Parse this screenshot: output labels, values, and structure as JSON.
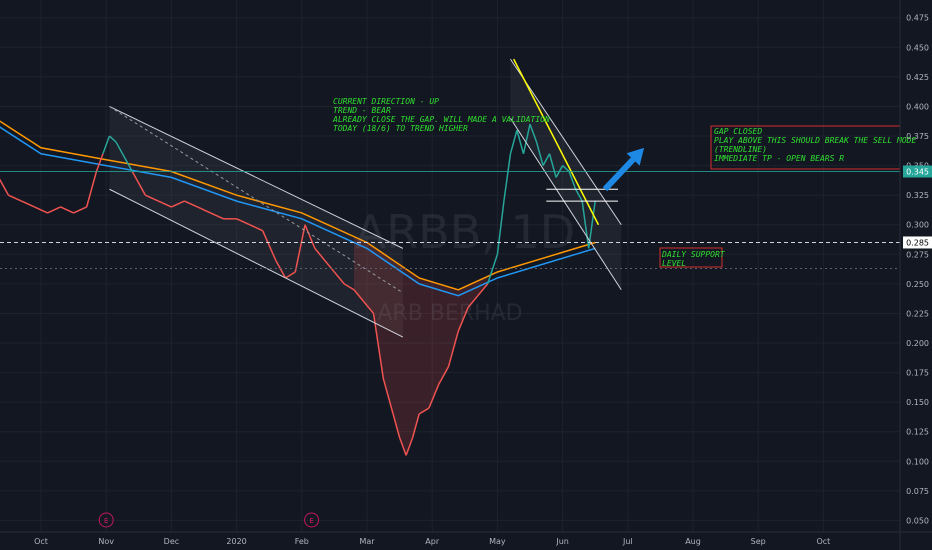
{
  "chart_data": {
    "type": "line",
    "symbol": "ARBB, 1D",
    "company": "ARB BERHAD",
    "x_tick_labels": [
      "Oct",
      "Nov",
      "Dec",
      "2020",
      "Feb",
      "Mar",
      "Apr",
      "May",
      "Jun",
      "Jul",
      "Aug",
      "Sep",
      "Oct"
    ],
    "ylim": [
      0.025,
      0.49
    ],
    "y_ticks": [
      0.05,
      0.075,
      0.1,
      0.125,
      0.15,
      0.175,
      0.2,
      0.225,
      0.25,
      0.275,
      0.3,
      0.325,
      0.35,
      0.375,
      0.4,
      0.425,
      0.45,
      0.475
    ],
    "y_tick_labels": [
      "0.050",
      "0.075",
      "0.100",
      "0.125",
      "0.150",
      "0.175",
      "0.200",
      "0.225",
      "0.250",
      "0.275",
      "0.300",
      "0.325",
      "0.350",
      "0.375",
      "0.400",
      "0.425",
      "0.450",
      "0.475"
    ],
    "x_positions_comment": "x = fraction of months elapsed from the 'Oct' (2019) tick",
    "price_series": [
      {
        "x": -0.7,
        "y": 0.345
      },
      {
        "x": -0.5,
        "y": 0.325
      },
      {
        "x": -0.3,
        "y": 0.32
      },
      {
        "x": -0.1,
        "y": 0.315
      },
      {
        "x": 0.1,
        "y": 0.31
      },
      {
        "x": 0.3,
        "y": 0.315
      },
      {
        "x": 0.5,
        "y": 0.31
      },
      {
        "x": 0.7,
        "y": 0.315
      },
      {
        "x": 0.85,
        "y": 0.345
      },
      {
        "x": 0.95,
        "y": 0.36
      },
      {
        "x": 1.05,
        "y": 0.375
      },
      {
        "x": 1.15,
        "y": 0.37
      },
      {
        "x": 1.25,
        "y": 0.36
      },
      {
        "x": 1.4,
        "y": 0.345
      },
      {
        "x": 1.6,
        "y": 0.325
      },
      {
        "x": 1.8,
        "y": 0.32
      },
      {
        "x": 2.0,
        "y": 0.315
      },
      {
        "x": 2.2,
        "y": 0.32
      },
      {
        "x": 2.4,
        "y": 0.315
      },
      {
        "x": 2.6,
        "y": 0.31
      },
      {
        "x": 2.8,
        "y": 0.305
      },
      {
        "x": 3.0,
        "y": 0.305
      },
      {
        "x": 3.2,
        "y": 0.3
      },
      {
        "x": 3.4,
        "y": 0.295
      },
      {
        "x": 3.6,
        "y": 0.27
      },
      {
        "x": 3.75,
        "y": 0.255
      },
      {
        "x": 3.9,
        "y": 0.26
      },
      {
        "x": 4.05,
        "y": 0.3
      },
      {
        "x": 4.2,
        "y": 0.28
      },
      {
        "x": 4.35,
        "y": 0.27
      },
      {
        "x": 4.5,
        "y": 0.26
      },
      {
        "x": 4.65,
        "y": 0.25
      },
      {
        "x": 4.8,
        "y": 0.245
      },
      {
        "x": 4.95,
        "y": 0.235
      },
      {
        "x": 5.1,
        "y": 0.225
      },
      {
        "x": 5.25,
        "y": 0.17
      },
      {
        "x": 5.4,
        "y": 0.14
      },
      {
        "x": 5.5,
        "y": 0.12
      },
      {
        "x": 5.6,
        "y": 0.105
      },
      {
        "x": 5.7,
        "y": 0.12
      },
      {
        "x": 5.8,
        "y": 0.14
      },
      {
        "x": 5.95,
        "y": 0.145
      },
      {
        "x": 6.1,
        "y": 0.165
      },
      {
        "x": 6.25,
        "y": 0.18
      },
      {
        "x": 6.4,
        "y": 0.21
      },
      {
        "x": 6.55,
        "y": 0.23
      },
      {
        "x": 6.7,
        "y": 0.24
      },
      {
        "x": 6.85,
        "y": 0.25
      },
      {
        "x": 7.0,
        "y": 0.275
      },
      {
        "x": 7.1,
        "y": 0.32
      },
      {
        "x": 7.2,
        "y": 0.36
      },
      {
        "x": 7.3,
        "y": 0.38
      },
      {
        "x": 7.4,
        "y": 0.36
      },
      {
        "x": 7.5,
        "y": 0.385
      },
      {
        "x": 7.6,
        "y": 0.37
      },
      {
        "x": 7.7,
        "y": 0.35
      },
      {
        "x": 7.8,
        "y": 0.36
      },
      {
        "x": 7.9,
        "y": 0.34
      },
      {
        "x": 8.0,
        "y": 0.35
      },
      {
        "x": 8.1,
        "y": 0.345
      },
      {
        "x": 8.2,
        "y": 0.33
      },
      {
        "x": 8.3,
        "y": 0.32
      },
      {
        "x": 8.4,
        "y": 0.28
      },
      {
        "x": 8.5,
        "y": 0.32
      }
    ],
    "ma_fast": [
      {
        "x": -0.7,
        "y": 0.39
      },
      {
        "x": 0.0,
        "y": 0.365
      },
      {
        "x": 1.0,
        "y": 0.355
      },
      {
        "x": 2.0,
        "y": 0.345
      },
      {
        "x": 3.0,
        "y": 0.325
      },
      {
        "x": 4.0,
        "y": 0.31
      },
      {
        "x": 5.0,
        "y": 0.285
      },
      {
        "x": 5.8,
        "y": 0.255
      },
      {
        "x": 6.4,
        "y": 0.245
      },
      {
        "x": 7.0,
        "y": 0.26
      },
      {
        "x": 7.6,
        "y": 0.27
      },
      {
        "x": 8.2,
        "y": 0.28
      },
      {
        "x": 8.5,
        "y": 0.285
      }
    ],
    "ma_slow": [
      {
        "x": -0.7,
        "y": 0.385
      },
      {
        "x": 0.0,
        "y": 0.36
      },
      {
        "x": 1.0,
        "y": 0.35
      },
      {
        "x": 2.0,
        "y": 0.34
      },
      {
        "x": 3.0,
        "y": 0.32
      },
      {
        "x": 4.0,
        "y": 0.305
      },
      {
        "x": 5.0,
        "y": 0.28
      },
      {
        "x": 5.8,
        "y": 0.25
      },
      {
        "x": 6.4,
        "y": 0.24
      },
      {
        "x": 7.0,
        "y": 0.255
      },
      {
        "x": 7.6,
        "y": 0.265
      },
      {
        "x": 8.2,
        "y": 0.275
      },
      {
        "x": 8.5,
        "y": 0.28
      }
    ],
    "channel_upper": [
      {
        "x": 1.05,
        "y": 0.4
      },
      {
        "x": 5.55,
        "y": 0.28
      }
    ],
    "channel_lower": [
      {
        "x": 1.05,
        "y": 0.33
      },
      {
        "x": 5.55,
        "y": 0.205
      }
    ],
    "wedge_upper": [
      {
        "x": 7.2,
        "y": 0.44
      },
      {
        "x": 8.9,
        "y": 0.3
      }
    ],
    "wedge_lower": [
      {
        "x": 7.2,
        "y": 0.39
      },
      {
        "x": 8.9,
        "y": 0.245
      }
    ],
    "gap_zone": [
      0.32,
      0.33
    ],
    "price_markers": [
      {
        "value": 0.345,
        "label": "0.345",
        "color": "#26a69a"
      },
      {
        "value": 0.285,
        "label": "0.285",
        "color": "#ffffff"
      }
    ],
    "arrow": {
      "from": {
        "x": 8.65,
        "y": 0.33
      },
      "to": {
        "x": 9.25,
        "y": 0.365
      }
    },
    "earnings_markers": [
      {
        "x": 1.0,
        "label": "E"
      },
      {
        "x": 4.15,
        "label": "E"
      }
    ]
  },
  "annotations": {
    "direction_note": [
      "CURRENT DIRECTION - UP",
      "TREND - BEAR",
      "",
      "ALREADY CLOSE THE GAP. WILL MADE A VALIDATION",
      "TODAY (18/6) TO TREND HIGHER"
    ],
    "gap_note": [
      "GAP CLOSED",
      "PLAY ABOVE THIS SHOULD BREAK THE SELL MODE",
      "(TRENDLINE)",
      "",
      "IMMEDIATE TP - OPEN BEARS R"
    ],
    "support_note": [
      "DAILY SUPPORT",
      "LEVEL"
    ]
  },
  "colors": {
    "background": "#131722",
    "price_up": "#26a69a",
    "price_down": "#ef5350",
    "ma_fast": "#ff9800",
    "ma_slow": "#2196f3",
    "trend_yellow": "#ffff00",
    "note_green": "#2fe02f",
    "box_red": "#d32f2f",
    "arrow_blue": "#1e88e5"
  }
}
